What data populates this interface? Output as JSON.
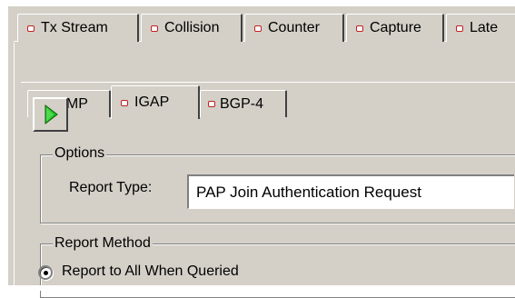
{
  "top_tabs": [
    {
      "label": "Tx Stream",
      "icon": "red-square-icon"
    },
    {
      "label": "Collision",
      "icon": "red-square-icon"
    },
    {
      "label": "Counter",
      "icon": "red-square-icon"
    },
    {
      "label": "Capture",
      "icon": "red-square-icon"
    },
    {
      "label": "Late",
      "icon": "red-square-icon"
    }
  ],
  "sub_tabs": [
    {
      "label": "IGMP",
      "icon": "red-square-icon"
    },
    {
      "label": "IGAP",
      "icon": "red-square-icon",
      "selected": true
    },
    {
      "label": "BGP-4",
      "icon": "red-square-icon"
    }
  ],
  "toolbar": {
    "run_icon": "play-icon"
  },
  "options": {
    "title": "Options",
    "report_type_label": "Report Type:",
    "report_type_value": "PAP Join Authentication Request"
  },
  "report_method": {
    "title": "Report Method",
    "selected_option": "Report to All When Queried"
  },
  "colors": {
    "play_green": "#20c020",
    "tab_dot_red": "#c02020",
    "face": "#d4d0c8"
  }
}
